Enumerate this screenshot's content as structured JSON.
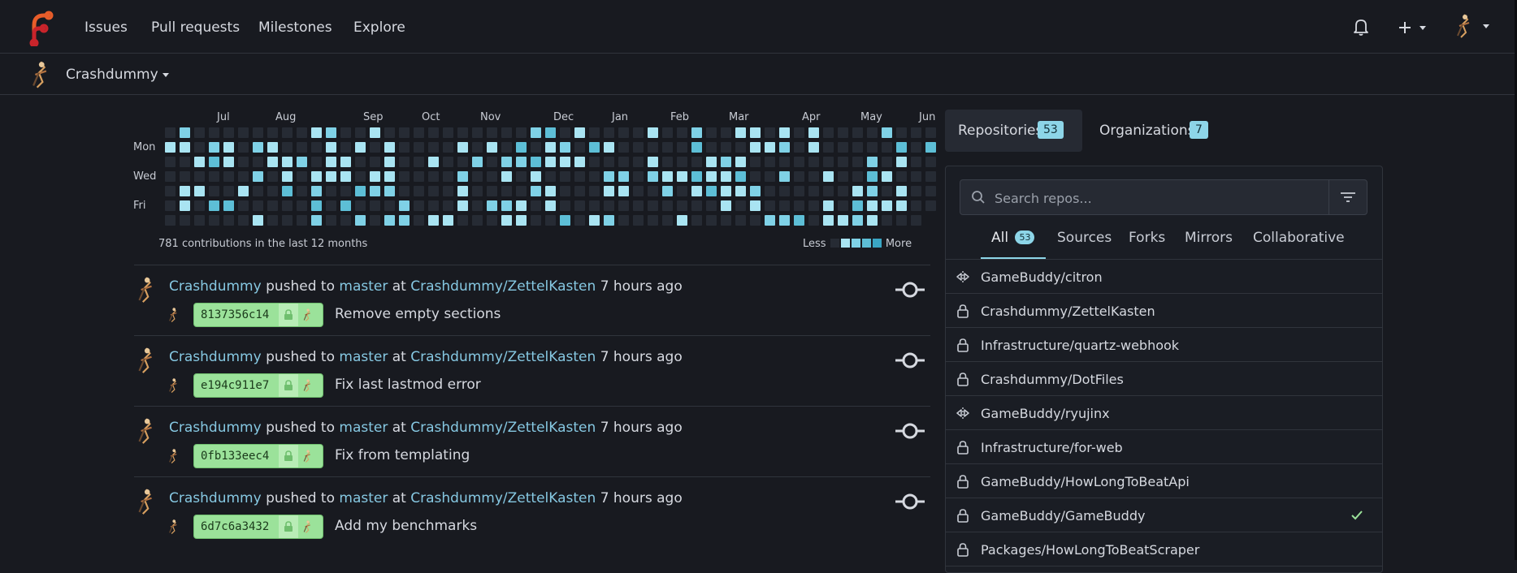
{
  "nav": {
    "items": [
      "Issues",
      "Pull requests",
      "Milestones",
      "Explore"
    ]
  },
  "context": {
    "name": "Crashdummy"
  },
  "heatmap": {
    "months": [
      "Jul",
      "Aug",
      "Sep",
      "Oct",
      "Nov",
      "Dec",
      "Jan",
      "Feb",
      "Mar",
      "Apr",
      "May",
      "Jun"
    ],
    "days": [
      "Mon",
      "Wed",
      "Fri"
    ],
    "summary": "781 contributions in the last 12 months",
    "less": "Less",
    "more": "More",
    "colors": [
      "#262b34",
      "#a9e4f2",
      "#7fd1e6",
      "#5dbed6",
      "#3aa6c4"
    ]
  },
  "feed": [
    {
      "user": "Crashdummy",
      "pushed": "pushed to",
      "branch": "master",
      "at": "at",
      "repo": "Crashdummy/ZettelKasten",
      "time": "7 hours ago",
      "sha": "8137356c14",
      "message": "Remove empty sections"
    },
    {
      "user": "Crashdummy",
      "pushed": "pushed to",
      "branch": "master",
      "at": "at",
      "repo": "Crashdummy/ZettelKasten",
      "time": "7 hours ago",
      "sha": "e194c911e7",
      "message": "Fix last lastmod error"
    },
    {
      "user": "Crashdummy",
      "pushed": "pushed to",
      "branch": "master",
      "at": "at",
      "repo": "Crashdummy/ZettelKasten",
      "time": "7 hours ago",
      "sha": "0fb133eec4",
      "message": "Fix from templating"
    },
    {
      "user": "Crashdummy",
      "pushed": "pushed to",
      "branch": "master",
      "at": "at",
      "repo": "Crashdummy/ZettelKasten",
      "time": "7 hours ago",
      "sha": "6d7c6a3432",
      "message": "Add my benchmarks"
    }
  ],
  "panel": {
    "tabs": {
      "repositories": {
        "label": "Repositories",
        "count": "53"
      },
      "organizations": {
        "label": "Organizations",
        "count": "7"
      }
    },
    "search": {
      "placeholder": "Search repos..."
    },
    "subtabs": [
      {
        "label": "All",
        "count": "53"
      },
      {
        "label": "Sources"
      },
      {
        "label": "Forks"
      },
      {
        "label": "Mirrors"
      },
      {
        "label": "Collaborative"
      }
    ],
    "repos": [
      {
        "name": "GameBuddy/citron",
        "icon": "mirror-icon"
      },
      {
        "name": "Crashdummy/ZettelKasten",
        "icon": "lock-icon"
      },
      {
        "name": "Infrastructure/quartz-webhook",
        "icon": "lock-icon"
      },
      {
        "name": "Crashdummy/DotFiles",
        "icon": "lock-icon"
      },
      {
        "name": "GameBuddy/ryujinx",
        "icon": "mirror-icon"
      },
      {
        "name": "Infrastructure/for-web",
        "icon": "lock-icon"
      },
      {
        "name": "GameBuddy/HowLongToBeatApi",
        "icon": "lock-icon"
      },
      {
        "name": "GameBuddy/GameBuddy",
        "icon": "lock-icon",
        "checked": true
      },
      {
        "name": "Packages/HowLongToBeatScraper",
        "icon": "lock-icon"
      }
    ]
  }
}
